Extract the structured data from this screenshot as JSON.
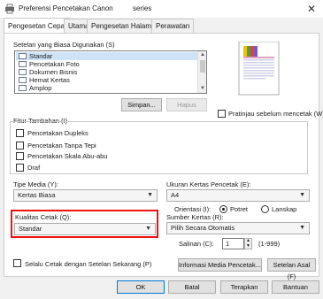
{
  "window": {
    "title": "Preferensi Pencetakan Canon series",
    "title_prefix": "Preferensi Pencetakan Canon",
    "title_suffix": "series",
    "close_glyph": "✕"
  },
  "tabs": [
    {
      "label": "Pengesetan Cepat",
      "active": true
    },
    {
      "label": "Utama",
      "active": false
    },
    {
      "label": "Pengesetan Halaman",
      "active": false
    },
    {
      "label": "Perawatan",
      "active": false
    }
  ],
  "presets": {
    "label": "Setelan yang Biasa Digunakan (S)",
    "items": [
      "Standar",
      "Pencetakan Foto",
      "Dokumen Bisnis",
      "Hemat Kertas",
      "Amplop"
    ],
    "selected_index": 0,
    "save_label": "Simpan...",
    "delete_label": "Hapus"
  },
  "preview_check_label": "Pratinjau sebelum mencetak (W)",
  "features": {
    "label": "Fitur Tambahan (I)",
    "items": [
      "Pencetakan Dupleks",
      "Pencetakan Tanpa Tepi",
      "Pencetakan Skala Abu-abu",
      "Draf"
    ]
  },
  "media_type": {
    "label": "Tipe Media (Y):",
    "value": "Kertas Biasa"
  },
  "paper_size": {
    "label": "Ukuran Kertas Pencetak (E):",
    "value": "A4"
  },
  "orientation": {
    "label": "Orientasi (I):",
    "options": [
      "Potret",
      "Lanskap"
    ],
    "selected": "Potret"
  },
  "quality": {
    "label": "Kualitas Cetak (Q):",
    "value": "Standar"
  },
  "paper_source": {
    "label": "Sumber Kertas (R):",
    "value": "Pilih Secara Otomatis"
  },
  "copies": {
    "label": "Salinan (C):",
    "value": "1",
    "range": "(1-999)"
  },
  "always_print_label": "Selalu Cetak dengan Setelan Sekarang (P)",
  "media_info_label": "Informasi Media Pencetak...",
  "defaults_label": "Setelan Asal (F)",
  "footer": {
    "ok": "OK",
    "cancel": "Batal",
    "apply": "Terapkan",
    "help": "Bantuan"
  },
  "colors": {
    "highlight_red": "#e11111",
    "selection_blue": "#cfe3f7",
    "accent_blue": "#0078d7"
  }
}
